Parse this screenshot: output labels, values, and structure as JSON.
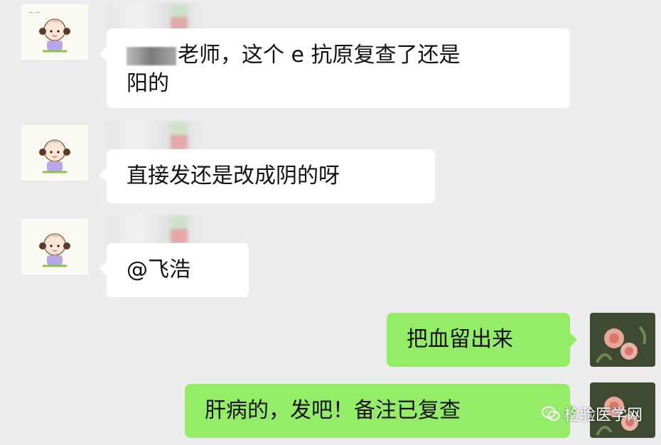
{
  "chat": {
    "messages": [
      {
        "direction": "incoming",
        "text": "老师，这个 e 抗原复查了还是阳的",
        "line1": "老师，这个 e 抗原复查了还是",
        "line2": "阳的"
      },
      {
        "direction": "incoming",
        "text": "直接发还是改成阴的呀"
      },
      {
        "direction": "incoming",
        "text": "@飞浩"
      },
      {
        "direction": "outgoing",
        "text": "把血留出来"
      },
      {
        "direction": "outgoing",
        "text": "肝病的，发吧！备注已复查"
      }
    ]
  },
  "watermark": {
    "text": "检验医学网"
  },
  "colors": {
    "background": "#ededed",
    "incoming_bubble": "#ffffff",
    "outgoing_bubble": "#95ec69"
  },
  "icons": {
    "incoming_avatar": "cartoon-girl-avatar-icon",
    "outgoing_avatar": "rose-avatar-icon",
    "watermark": "wechat-logo-icon"
  }
}
